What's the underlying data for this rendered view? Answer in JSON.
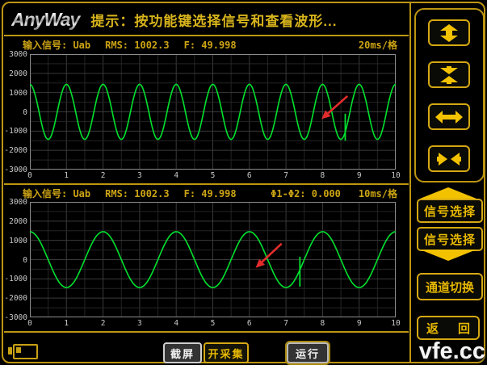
{
  "header": {
    "logo": "AnyWay",
    "prompt": "提示：按功能键选择信号和查看波形..."
  },
  "charts": [
    {
      "signal": "输入信号: Uab",
      "rms": "RMS: 1002.3",
      "freq": "F: 49.998",
      "timebase": "20ms/格"
    },
    {
      "signal": "输入信号: Uab",
      "rms": "RMS: 1002.3",
      "freq": "F: 49.998",
      "phase": "Φ1-Φ2: 0.000",
      "timebase": "10ms/格"
    }
  ],
  "chart_data": [
    {
      "type": "line",
      "title": "输入信号 Uab 波形 (上)",
      "signal": "Uab",
      "rms": 1002.3,
      "frequency_hz": 49.998,
      "time_per_division": "20ms/格",
      "x_max": 10,
      "xticks": [
        0,
        1,
        2,
        3,
        4,
        5,
        6,
        7,
        8,
        9,
        10
      ],
      "ylim": [
        -3000,
        3000
      ],
      "yticks": [
        3000,
        2000,
        1000,
        0,
        -1000,
        -2000,
        -3000
      ],
      "waveform": "cosine",
      "amplitude": 1430,
      "cycles_per_division": 1,
      "grid": {
        "x_minor": 0.5,
        "y_minor": 500
      },
      "glitch": {
        "x": 8.62,
        "y1": -1500,
        "y2": -100
      },
      "arrow": {
        "from": [
          8.68,
          820
        ],
        "to": [
          7.97,
          -380
        ]
      }
    },
    {
      "type": "line",
      "title": "输入信号 Uab 波形 (下)",
      "signal": "Uab",
      "rms": 1002.3,
      "frequency_hz": 49.998,
      "phase_delta": "Φ1-Φ2: 0.000",
      "time_per_division": "10ms/格",
      "x_max": 10,
      "xticks": [
        0,
        1,
        2,
        3,
        4,
        5,
        6,
        7,
        8,
        9,
        10
      ],
      "ylim": [
        -3000,
        3000
      ],
      "yticks": [
        3000,
        2000,
        1000,
        0,
        -1000,
        -2000,
        -3000
      ],
      "waveform": "cosine",
      "amplitude": 1450,
      "cycles_per_division": 0.5,
      "grid": {
        "x_minor": 0.5,
        "y_minor": 500
      },
      "glitch": {
        "x": 7.38,
        "y1": -1400,
        "y2": 150
      },
      "arrow": {
        "from": [
          6.88,
          830
        ],
        "to": [
          6.17,
          -430
        ]
      }
    }
  ],
  "sidebar": {
    "zoom_icons": [
      "expand-vertical",
      "compress-vertical",
      "expand-horizontal",
      "compress-horizontal"
    ],
    "signal_select_up": "信号选择",
    "signal_select_down": "信号选择",
    "channel_switch": "通道切换",
    "back_left": "返",
    "back_right": "回"
  },
  "bottom_bar": {
    "screenshot": "截屏",
    "start_capture": "开采集",
    "run": "运行"
  },
  "watermark": "vfe.cc",
  "colors": {
    "frame_yellow": "#bd9610",
    "text_yellow": "#cda414",
    "bright_yellow": "#f2c200",
    "waveform_green": "#00e22e",
    "arrow_red": "#e22c2c",
    "grid_minor": "#242424",
    "grid_major": "#3a3a3a"
  }
}
